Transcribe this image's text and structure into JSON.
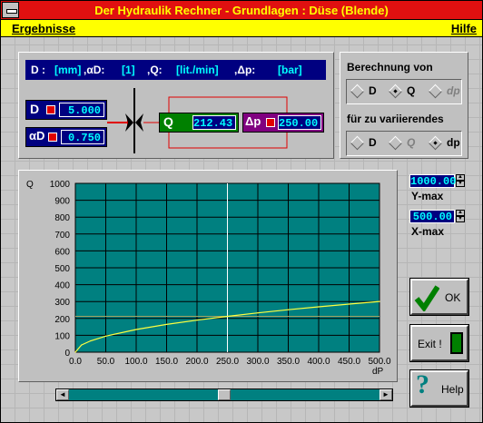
{
  "window": {
    "title": "Der Hydraulik Rechner - Grundlagen : Düse (Blende)"
  },
  "menu": {
    "left": "Ergebnisse",
    "right": "Hilfe"
  },
  "units_bar": {
    "d_label": "D :",
    "d_unit": "[mm]",
    "alpha_label": ",αD:",
    "alpha_unit": "[1]",
    "q_label": ",Q:",
    "q_unit": "[lit./min]",
    "dp_label": ",Δp:",
    "dp_unit": "[bar]"
  },
  "inputs": {
    "d": {
      "label": "D",
      "value": "5.000"
    },
    "alpha": {
      "label": "αD",
      "value": "0.750"
    },
    "q": {
      "label": "Q",
      "value": "212.43"
    },
    "dp": {
      "label": "Δp",
      "value": "250.00"
    }
  },
  "berechnung": {
    "title": "Berechnung von",
    "options": [
      {
        "label": "D",
        "selected": false,
        "enabled": true
      },
      {
        "label": "Q",
        "selected": true,
        "enabled": true
      },
      {
        "label": "dp",
        "selected": false,
        "enabled": false
      }
    ]
  },
  "variierend": {
    "title": "für zu variierendes",
    "options": [
      {
        "label": "D",
        "selected": false,
        "enabled": true
      },
      {
        "label": "Q",
        "selected": false,
        "enabled": false
      },
      {
        "label": "dp",
        "selected": true,
        "enabled": true
      }
    ]
  },
  "ymax": {
    "value": "1000.00",
    "label": "Y-max"
  },
  "xmax": {
    "value": "500.00",
    "label": "X-max"
  },
  "buttons": {
    "ok": "OK",
    "exit": "Exit !",
    "help": "Help"
  },
  "colors": {
    "plot_bg": "#008080",
    "curve": "#ffff40",
    "title_bg": "#e01010",
    "title_fg": "#ffff00"
  },
  "chart_data": {
    "type": "line",
    "ylabel": "Q",
    "xlabel": "dP",
    "xlim": [
      0,
      500
    ],
    "ylim": [
      0,
      1000
    ],
    "x_ticks": [
      "0.0",
      "50.0",
      "100.0",
      "150.0",
      "200.0",
      "250.0",
      "300.0",
      "350.0",
      "400.0",
      "450.0",
      "500.0"
    ],
    "y_ticks": [
      "0",
      "100",
      "200",
      "300",
      "400",
      "500",
      "600",
      "700",
      "800",
      "900",
      "1000"
    ],
    "grid": true,
    "series": [
      {
        "x": [
          0,
          10,
          25,
          50,
          100,
          150,
          200,
          250,
          300,
          350,
          400,
          450,
          500
        ],
        "values": [
          0,
          42.5,
          67.2,
          95.0,
          134.4,
          164.6,
          190.0,
          212.43,
          232.7,
          251.4,
          268.7,
          285.0,
          300.4
        ]
      }
    ],
    "cursor_x": 250,
    "reference_y": 212.43
  }
}
